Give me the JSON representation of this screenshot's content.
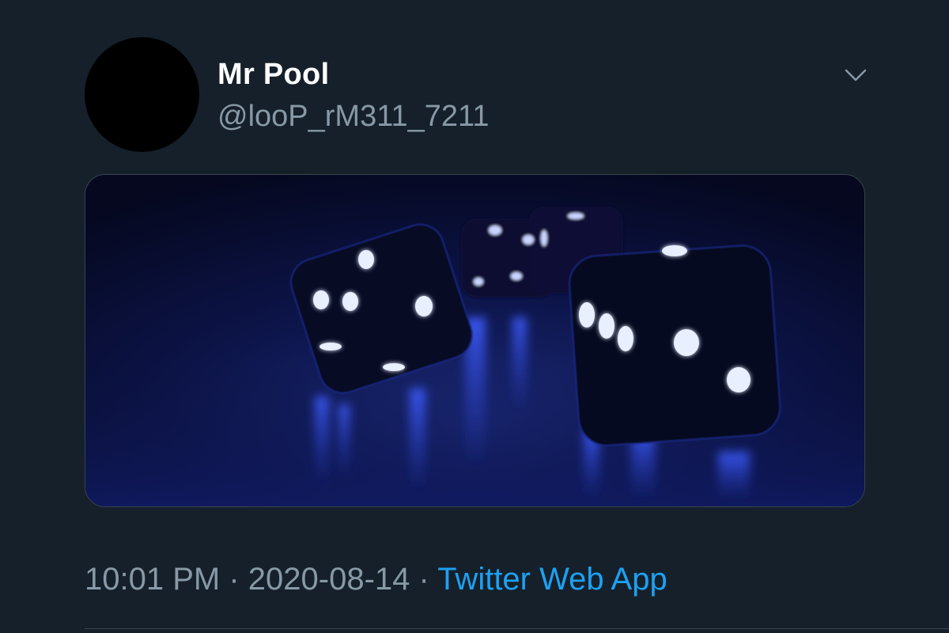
{
  "tweet": {
    "display_name": "Mr Pool",
    "handle": "@looP_rM311_7211",
    "time": "10:01 PM",
    "separator": " · ",
    "date": "2020-08-14",
    "source": "Twitter Web App",
    "menu_icon": "chevron-down-icon",
    "media_description_icon": "dice-photo"
  },
  "colors": {
    "background": "#15202b",
    "name": "#ffffff",
    "secondary_text": "#8899a6",
    "link": "#1da1f2",
    "border": "#38444d"
  }
}
